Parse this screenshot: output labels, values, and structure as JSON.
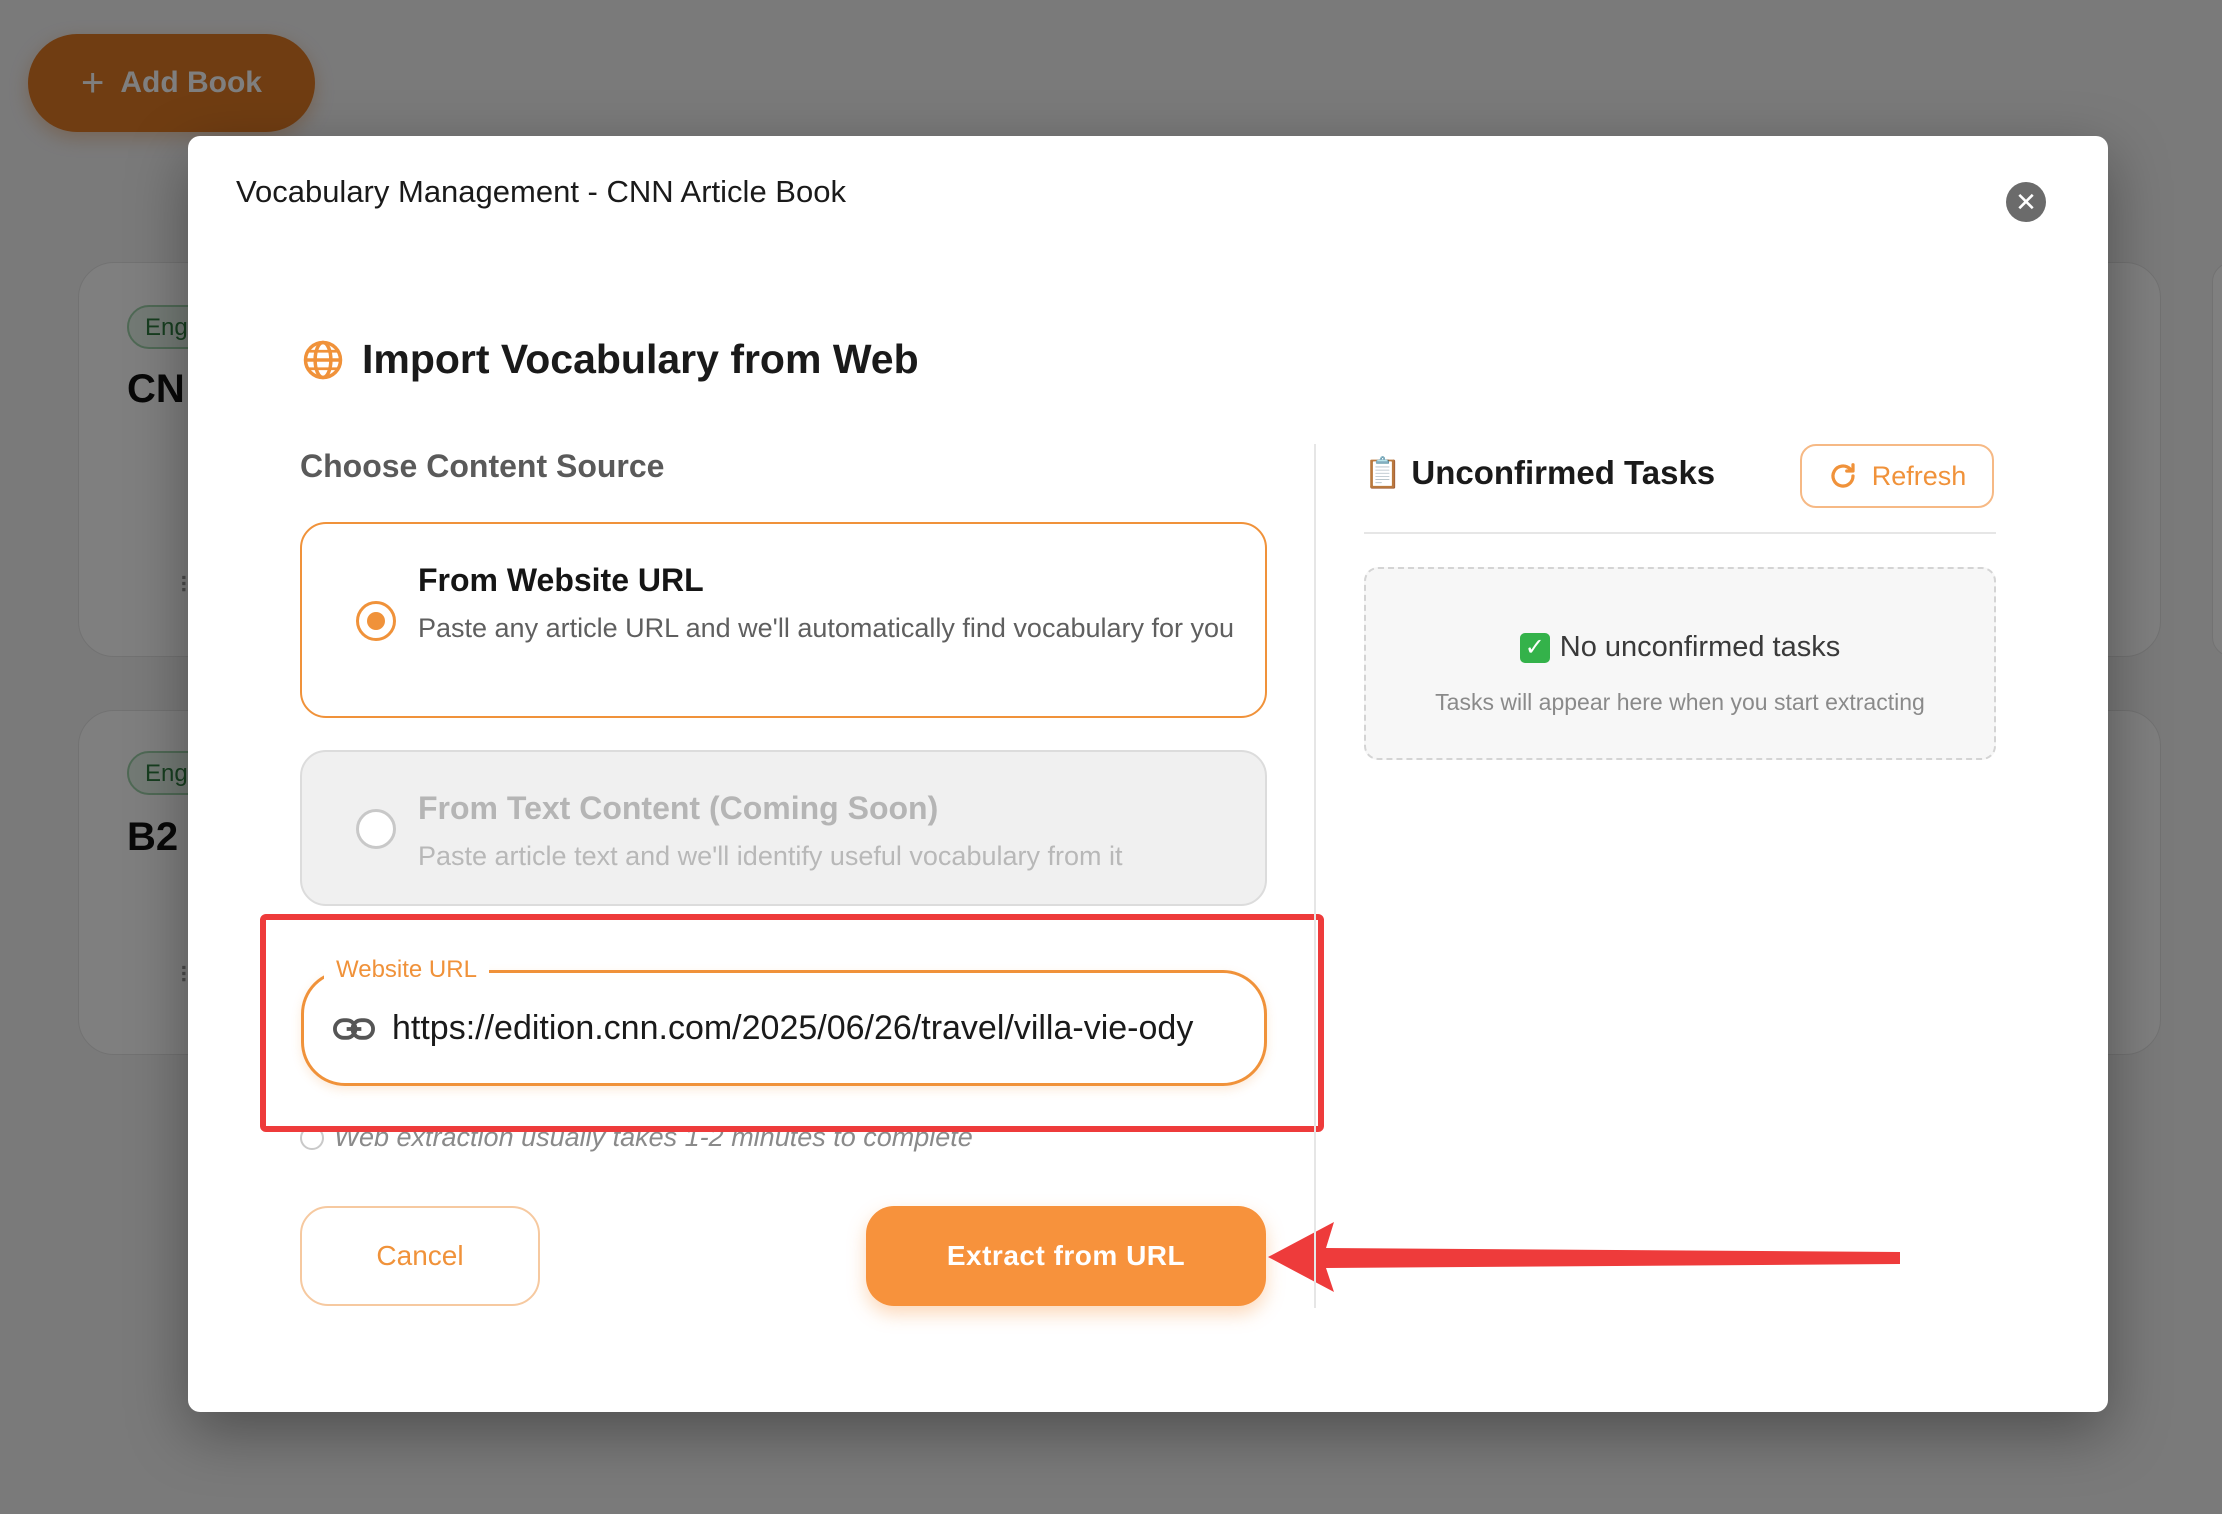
{
  "background": {
    "add_book_label": "Add Book",
    "cards": [
      {
        "lang": "Eng",
        "title": "CN"
      },
      {
        "lang": "Eng",
        "title": "B2"
      }
    ]
  },
  "modal": {
    "title": "Vocabulary Management - CNN Article Book",
    "section_title": "Import Vocabulary from Web",
    "choose_label": "Choose Content Source",
    "options": [
      {
        "title": "From Website URL",
        "description": "Paste any article URL and we'll automatically find vocabulary for you",
        "selected": true
      },
      {
        "title": "From Text Content (Coming Soon)",
        "description": "Paste article text and we'll identify useful vocabulary from it",
        "selected": false
      }
    ],
    "url_field": {
      "label": "Website URL",
      "value": "https://edition.cnn.com/2025/06/26/travel/villa-vie-ody"
    },
    "hint": "Web extraction usually takes 1-2 minutes to complete",
    "cancel_label": "Cancel",
    "extract_label": "Extract from URL",
    "tasks": {
      "title": "Unconfirmed Tasks",
      "refresh_label": "Refresh",
      "empty_title": "No unconfirmed tasks",
      "empty_subtitle": "Tasks will appear here when you start extracting"
    }
  },
  "colors": {
    "accent": "#f7923c",
    "annotation": "#ee3b3b",
    "success": "#34b24a"
  }
}
